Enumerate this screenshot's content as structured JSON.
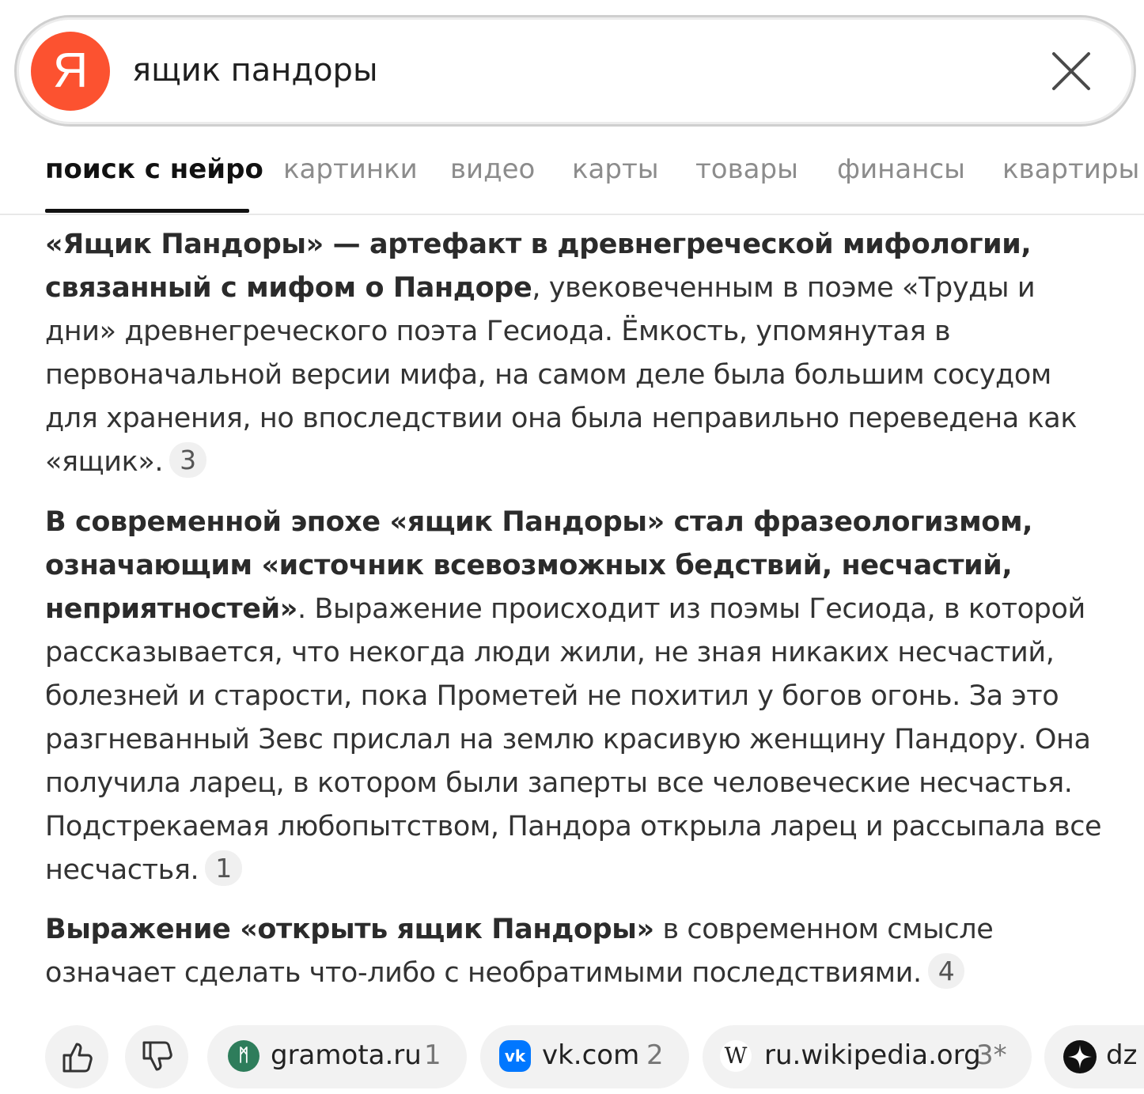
{
  "search": {
    "logo_letter": "Я",
    "query": "ящик пандоры"
  },
  "tabs": [
    {
      "label": "поиск с нейро"
    },
    {
      "label": "картинки"
    },
    {
      "label": "видео"
    },
    {
      "label": "карты"
    },
    {
      "label": "товары"
    },
    {
      "label": "финансы"
    },
    {
      "label": "квартиры"
    }
  ],
  "answer": {
    "p1_bold": "«Ящик Пандоры» — артефакт в древнегреческой мифологии, связанный с мифом о Пандоре",
    "p1_text": ", увековеченным в поэме «Труды и дни» древнегреческого поэта Гесиода. Ёмкость, упомянутая в первоначальной версии мифа, на самом деле была большим сосудом для хранения, но впоследствии она была неправильно переведена как «ящик».",
    "p1_ref": "3",
    "p2_bold": "В современной эпохе «ящик Пандоры» стал фразеологизмом, означающим «источник всевозможных бедствий, несчастий, неприятностей»",
    "p2_text": ". Выражение происходит из поэмы Гесиода, в которой рассказывается, что некогда люди жили, не зная никаких несчастий, болезней и старости, пока Прометей не похитил у богов огонь. За это разгневанный Зевс прислал на землю красивую женщину Пандору. Она получила ларец, в котором были заперты все человеческие несчастья. Подстрекаемая любопытством, Пандора открыла ларец и рассыпала все несчастья.",
    "p2_ref": "1",
    "p3_bold": "Выражение «открыть ящик Пандоры»",
    "p3_text": " в современном смысле означает сделать что-либо с необратимыми последствиями.",
    "p3_ref": "4"
  },
  "sources": [
    {
      "name": "gramota.ru",
      "num": "1",
      "icon": "gramota-icon",
      "color": "#2e8b57"
    },
    {
      "name": "vk.com",
      "num": "2",
      "icon": "vk-icon",
      "color": "#0077ff"
    },
    {
      "name": "ru.wikipedia.org",
      "num": "3*",
      "icon": "wikipedia-icon",
      "color": "#ffffff"
    },
    {
      "name": "dz",
      "num": "",
      "icon": "dzen-icon",
      "color": "#111111"
    }
  ],
  "sources_fav": {
    "gramota": "ᛗ",
    "vk": "vk",
    "wiki": "W"
  },
  "colors": {
    "brand": "#fc5230",
    "tab_active": "#111111",
    "tab_inactive": "#8c8c8c"
  }
}
